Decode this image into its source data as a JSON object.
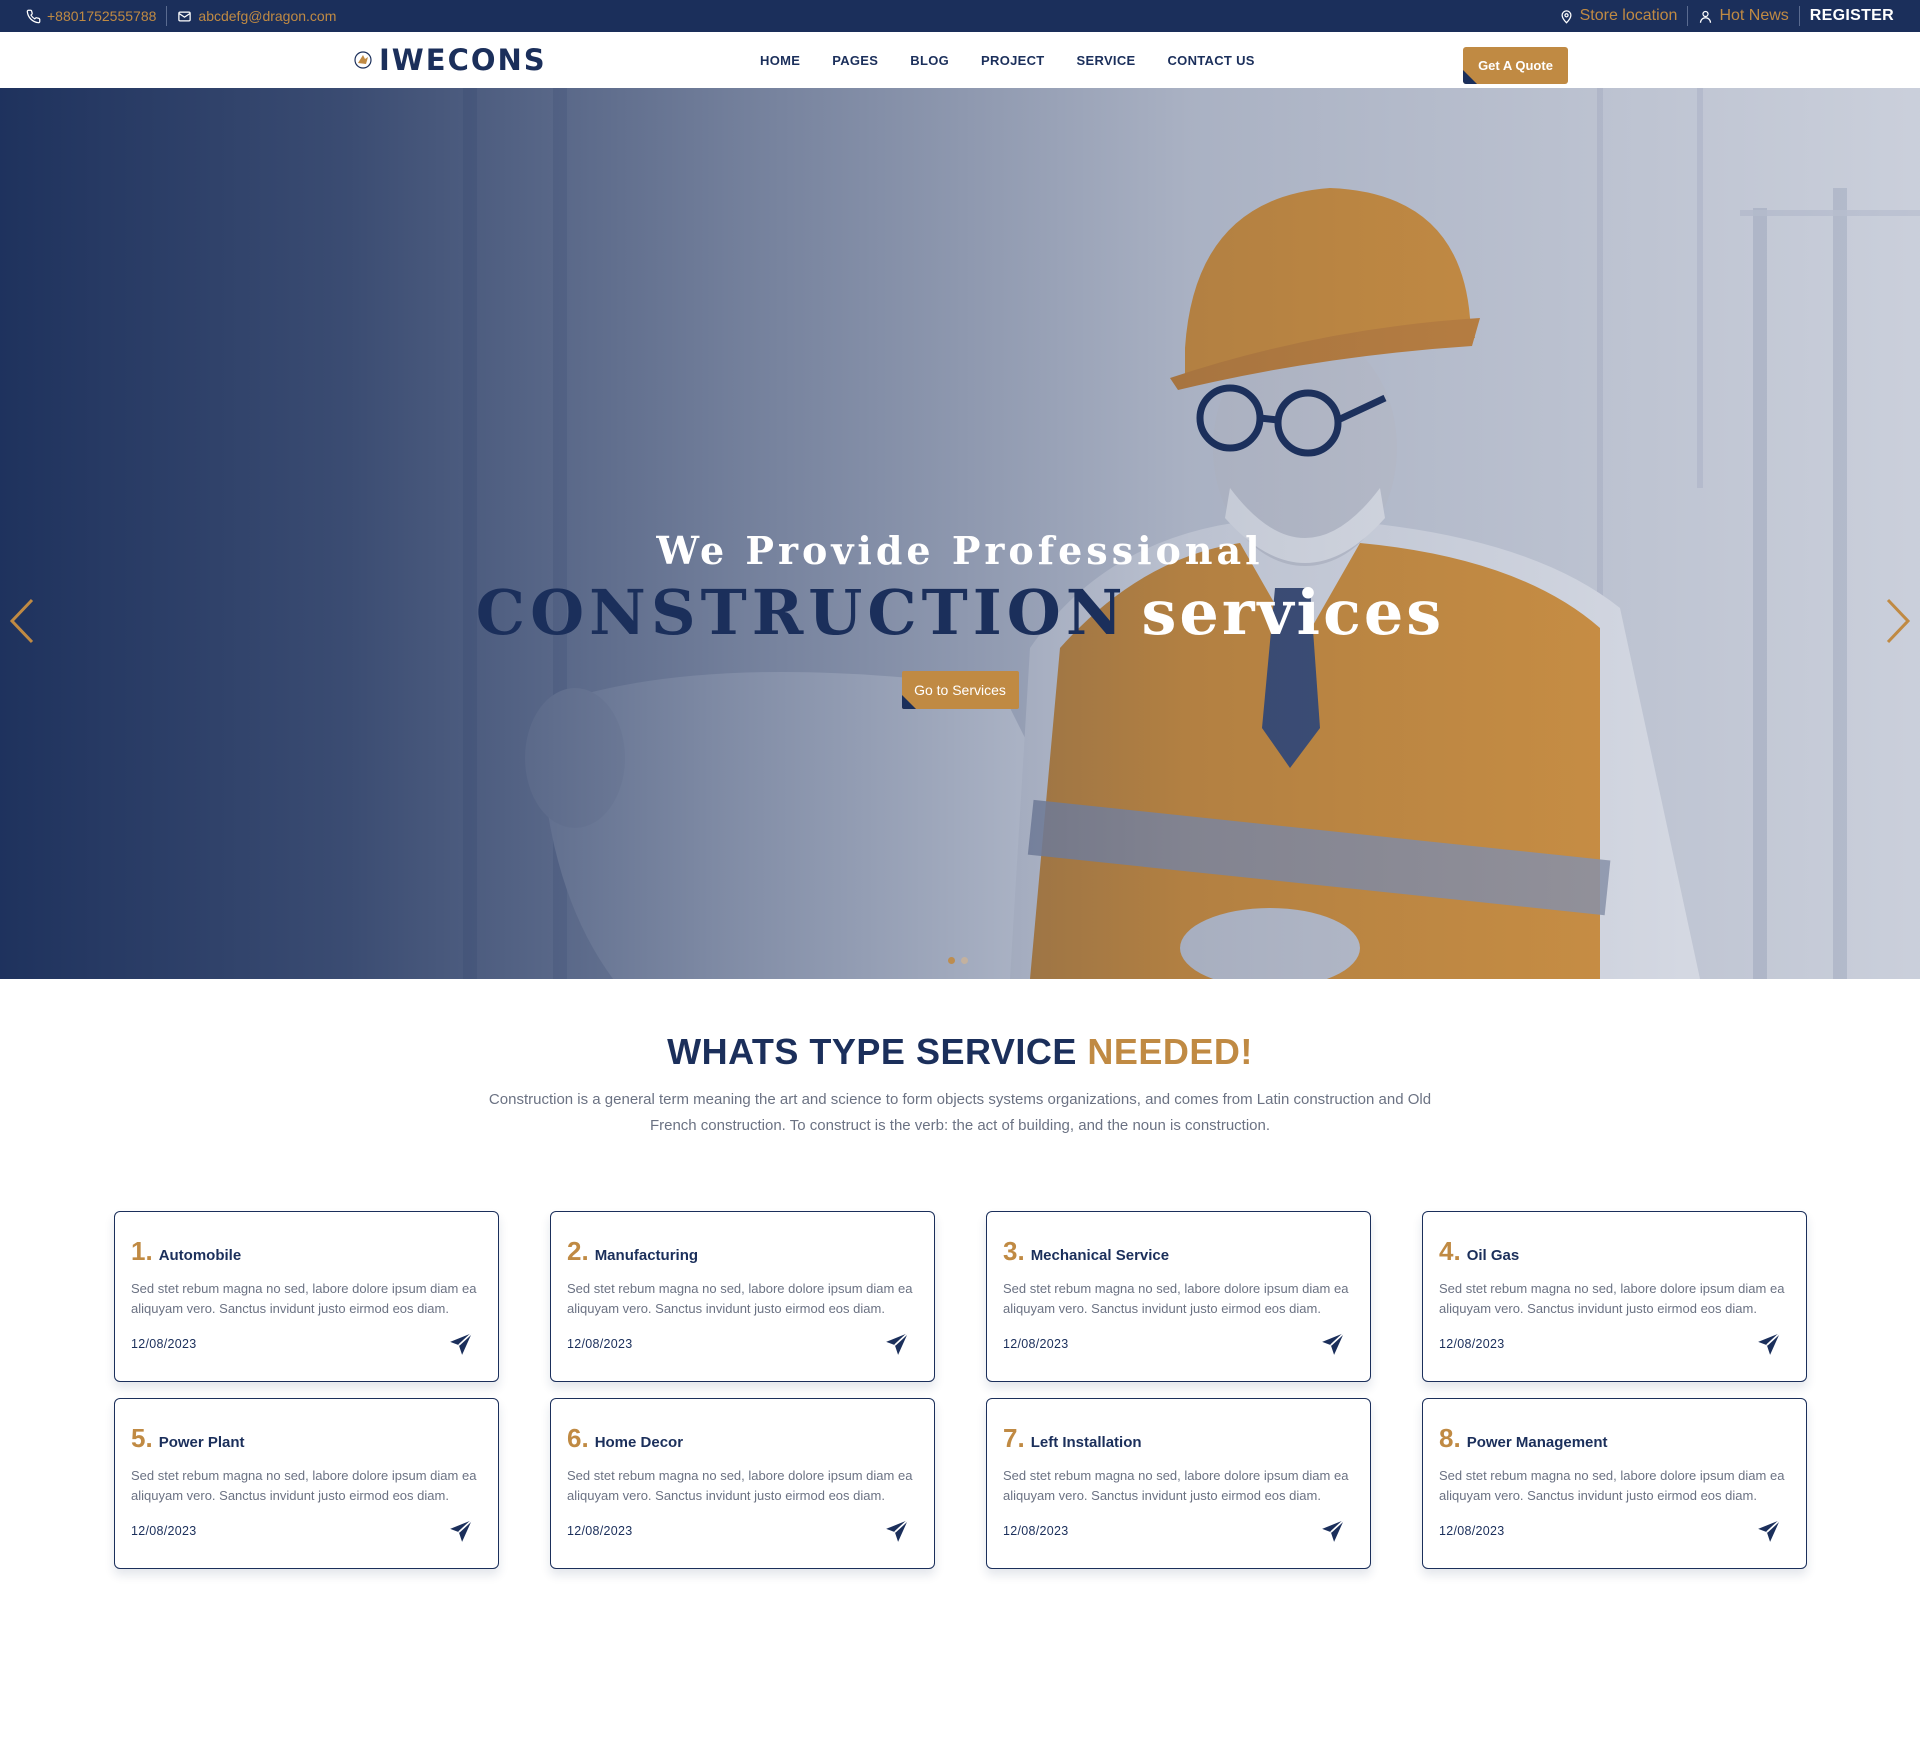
{
  "topbar": {
    "phone": "+8801752555788",
    "email": "abcdefg@dragon.com",
    "store_location": "Store location",
    "hot_news": "Hot News",
    "register": "REGISTER"
  },
  "header": {
    "logo_text": "IWECONS",
    "nav": [
      "HOME",
      "PAGES",
      "BLOG",
      "PROJECT",
      "SERVICE",
      "CONTACT US"
    ],
    "quote_button": "Get A Quote"
  },
  "hero": {
    "line1": "We Provide Professional",
    "line2_dark": "CONSTRUCTION",
    "line2_light": "services",
    "button": "Go to Services",
    "active_slide": 1,
    "slide_count": 2
  },
  "services": {
    "title_main": "WHATS TYPE SERVICE",
    "title_accent": "NEEDED!",
    "description": "Construction is a general term meaning the art and science to form objects systems organizations, and comes from Latin construction and Old French construction. To construct is the verb: the act of building, and the noun is construction.",
    "cards": [
      {
        "num": "1.",
        "name": "Automobile",
        "text": "Sed stet rebum magna no sed, labore dolore ipsum diam ea aliquyam vero. Sanctus invidunt justo eirmod eos diam.",
        "date": "12/08/2023"
      },
      {
        "num": "2.",
        "name": "Manufacturing",
        "text": "Sed stet rebum magna no sed, labore dolore ipsum diam ea aliquyam vero. Sanctus invidunt justo eirmod eos diam.",
        "date": "12/08/2023"
      },
      {
        "num": "3.",
        "name": "Mechanical Service",
        "text": "Sed stet rebum magna no sed, labore dolore ipsum diam ea aliquyam vero. Sanctus invidunt justo eirmod eos diam.",
        "date": "12/08/2023"
      },
      {
        "num": "4.",
        "name": "Oil Gas",
        "text": "Sed stet rebum magna no sed, labore dolore ipsum diam ea aliquyam vero. Sanctus invidunt justo eirmod eos diam.",
        "date": "12/08/2023"
      },
      {
        "num": "5.",
        "name": "Power Plant",
        "text": "Sed stet rebum magna no sed, labore dolore ipsum diam ea aliquyam vero. Sanctus invidunt justo eirmod eos diam.",
        "date": "12/08/2023"
      },
      {
        "num": "6.",
        "name": "Home Decor",
        "text": "Sed stet rebum magna no sed, labore dolore ipsum diam ea aliquyam vero. Sanctus invidunt justo eirmod eos diam.",
        "date": "12/08/2023"
      },
      {
        "num": "7.",
        "name": "Left Installation",
        "text": "Sed stet rebum magna no sed, labore dolore ipsum diam ea aliquyam vero. Sanctus invidunt justo eirmod eos diam.",
        "date": "12/08/2023"
      },
      {
        "num": "8.",
        "name": "Power Management",
        "text": "Sed stet rebum magna no sed, labore dolore ipsum diam ea aliquyam vero. Sanctus invidunt justo eirmod eos diam.",
        "date": "12/08/2023"
      }
    ]
  },
  "icons": {
    "phone": "phone-icon",
    "email": "mail-icon",
    "store": "map-pin-icon",
    "news": "user-icon",
    "prev": "chevron-left-icon",
    "next": "chevron-right-icon",
    "card": "paper-plane-icon"
  },
  "colors": {
    "navy": "#1b2f5b",
    "gold": "#c08a43",
    "text_gray": "#6b7283",
    "white": "#ffffff"
  }
}
